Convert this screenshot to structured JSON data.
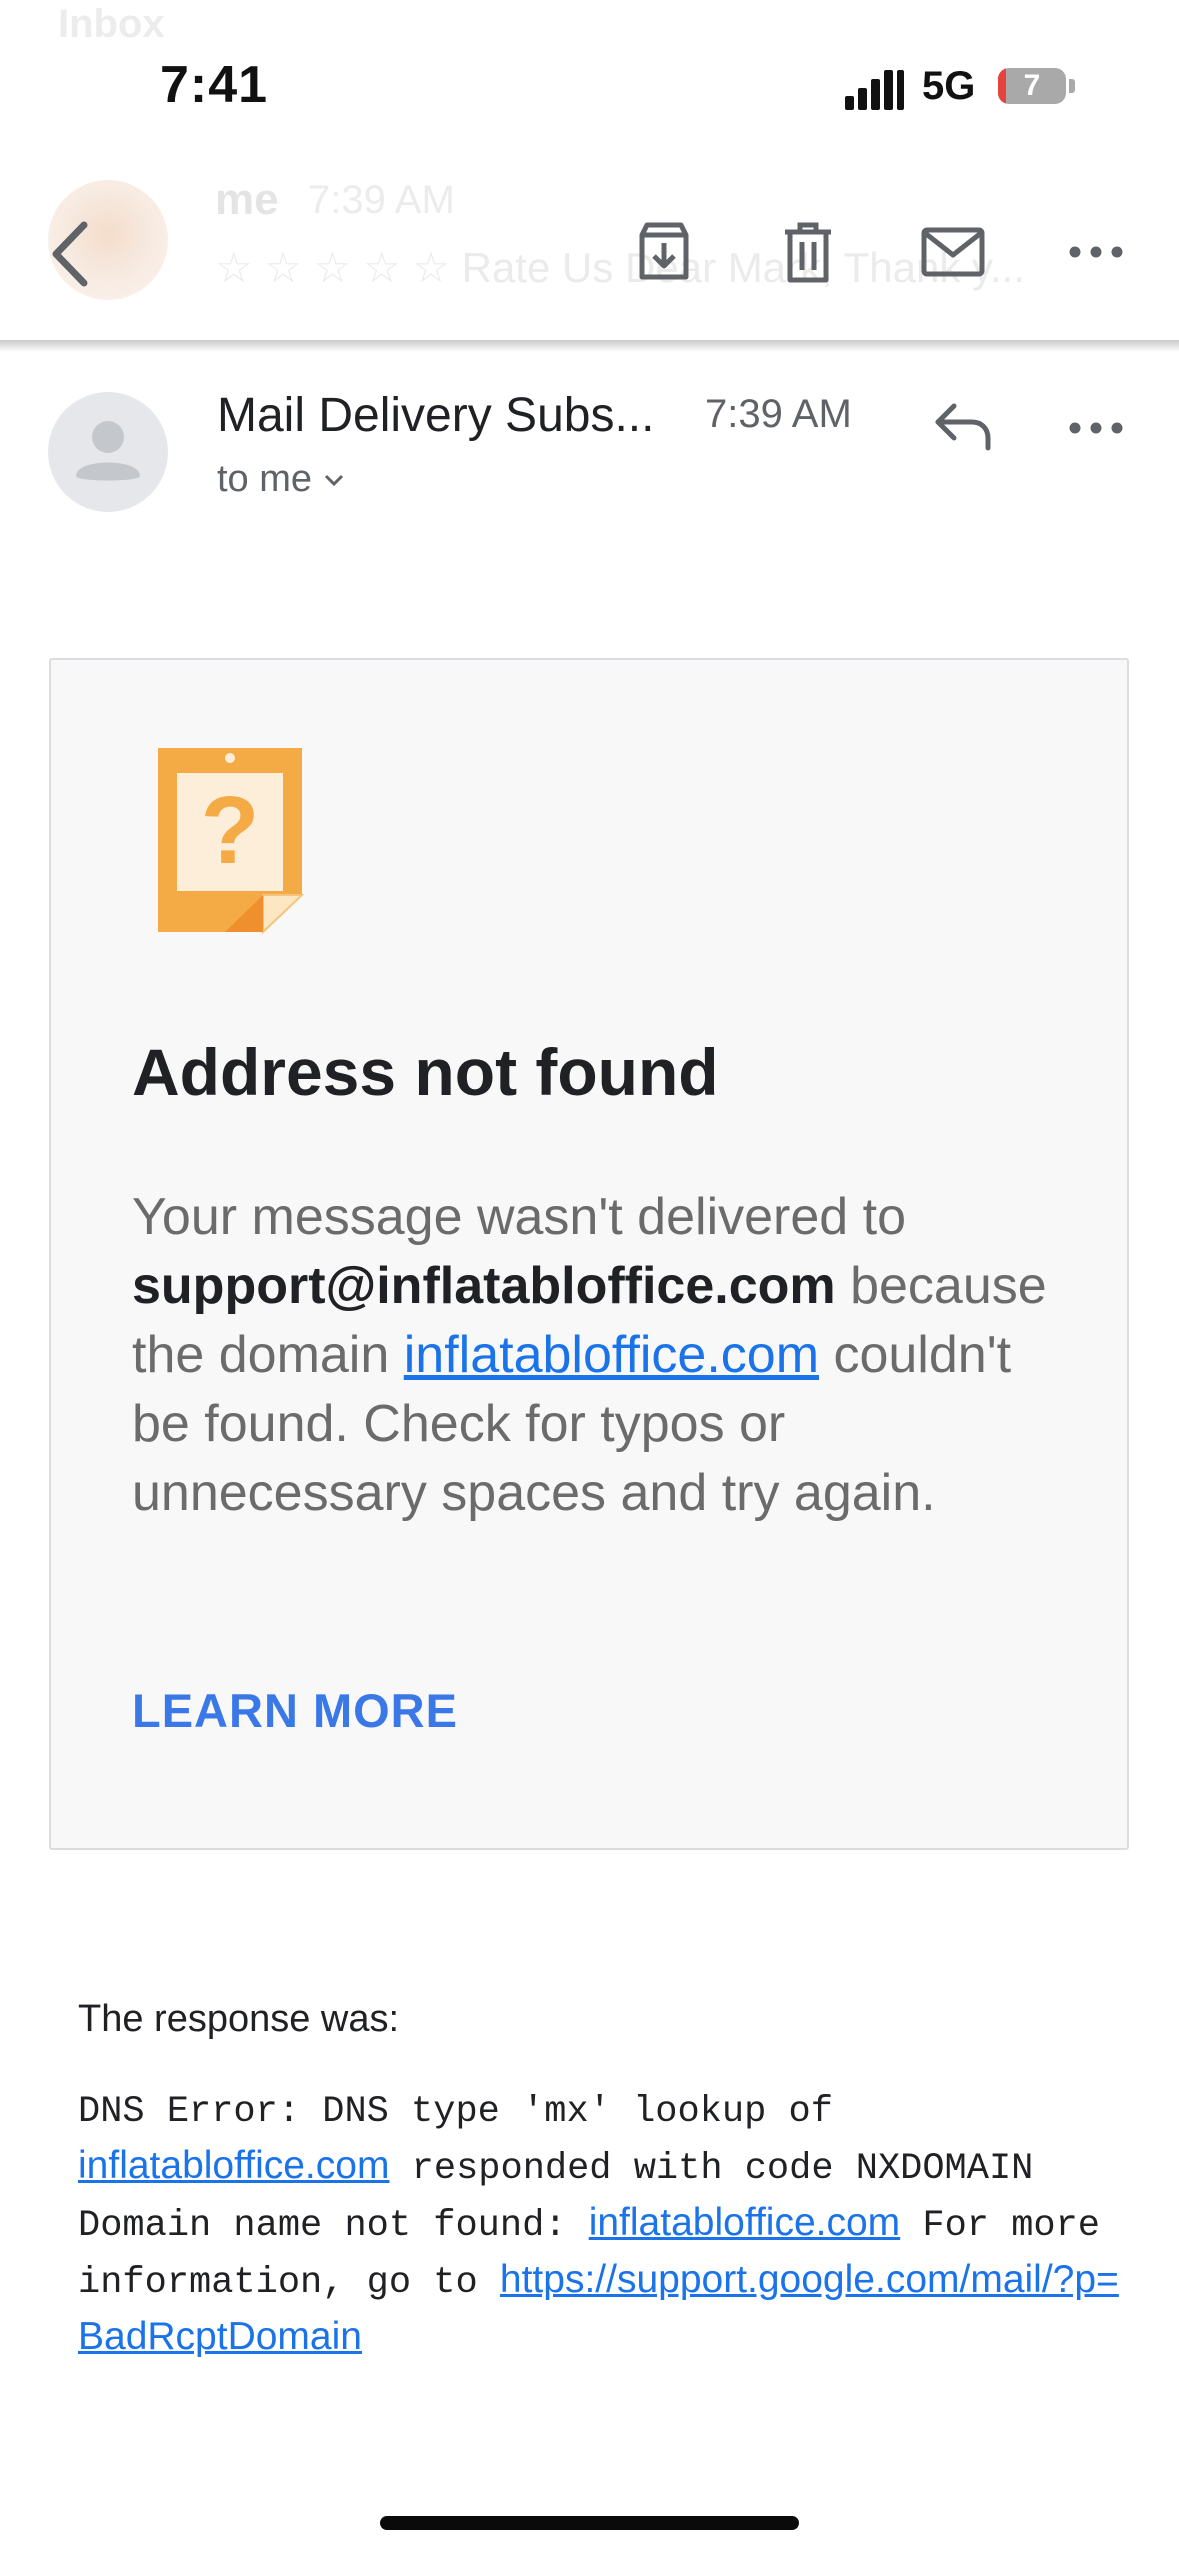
{
  "status_bar": {
    "time": "7:41",
    "network": "5G",
    "battery_level": "7",
    "battery_fraction": 0.07
  },
  "ghost_list": {
    "title": "Inbox",
    "sender": "me",
    "time": "7:39 AM",
    "subject": "☆ ☆ ☆ ☆ ☆ Rate Us Dear Mark, Thank y..."
  },
  "toolbar": {
    "icons": [
      "back-chevron-icon",
      "archive-icon",
      "trash-icon",
      "mark-unread-icon",
      "more-icon"
    ]
  },
  "message": {
    "sender": "Mail Delivery Subs...",
    "time": "7:39 AM",
    "recipient": "to me"
  },
  "bounce_card": {
    "icon": "question-note-icon",
    "title": "Address not found",
    "body_part1": "Your message wasn't delivered to",
    "address": "support@inflatabloffice.com",
    "body_part2": "because the domain",
    "domain_link": "inflatabloffice.com",
    "body_part3": "couldn't be found. Check for typos or unnecessary spaces and try again.",
    "learn_more": "LEARN MORE"
  },
  "response": {
    "label": "The response was:",
    "line1": "DNS Error: DNS type 'mx' lookup of",
    "link1": "inflatabloffice.com",
    "line2": "responded with code NXDOMAIN Domain name not found:",
    "link2": "inflatabloffice.com",
    "line3": "For more information, go to",
    "link3": "https://support.google.com/mail/?p=BadRcptDomain"
  },
  "colors": {
    "link": "#1a73e8",
    "learn_more": "#3b78e7",
    "card_bg": "#f8f8f8",
    "note_orange": "#f4ab45",
    "battery_red": "#e5433c"
  }
}
